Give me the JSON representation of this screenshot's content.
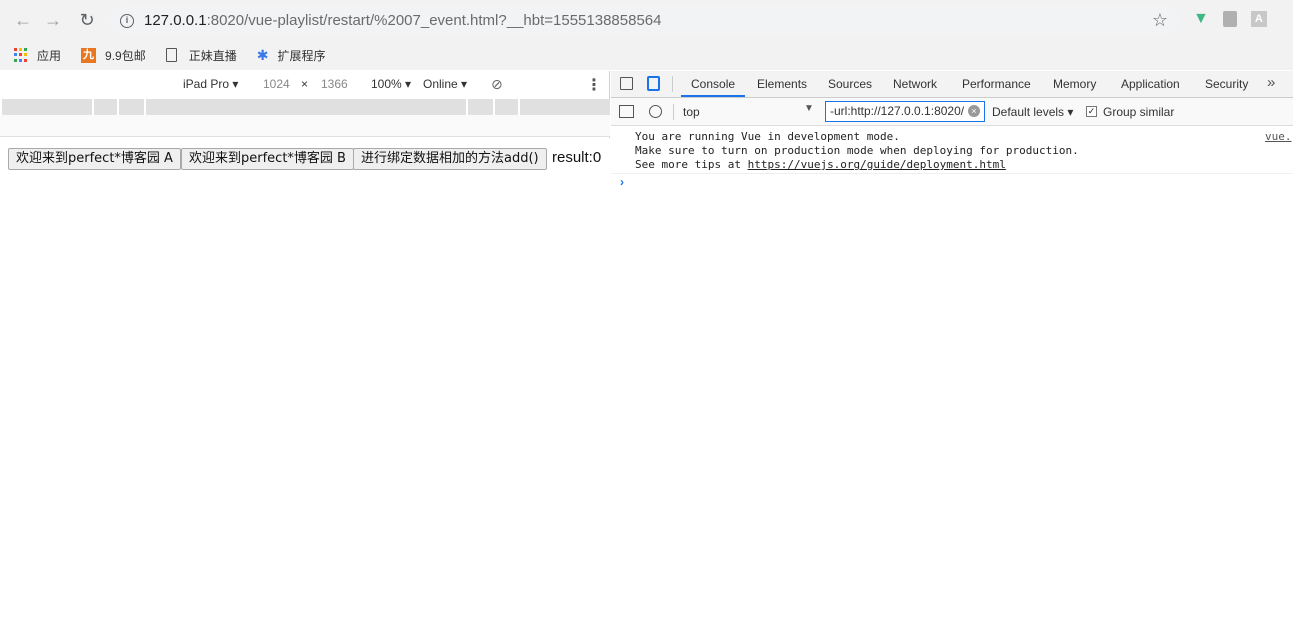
{
  "browser": {
    "url_host": "127.0.0.1",
    "url_path": ":8020/vue-playlist/restart/%2007_event.html?__hbt=1555138858564",
    "ext_letter": "A"
  },
  "bookmarks": [
    {
      "label": "应用"
    },
    {
      "label": "9.9包邮",
      "icon_text": "九"
    },
    {
      "label": "正妹直播"
    },
    {
      "label": "扩展程序"
    }
  ],
  "device_toolbar": {
    "device": "iPad Pro",
    "width": "1024",
    "times": "×",
    "height": "1366",
    "zoom": "100%",
    "network": "Online"
  },
  "page": {
    "buttons": [
      {
        "label": "欢迎来到perfect*博客园 A"
      },
      {
        "label": "欢迎来到perfect*博客园 B"
      },
      {
        "label": "进行绑定数据相加的方法add()"
      }
    ],
    "result": "result:0"
  },
  "devtools": {
    "tabs": [
      "Console",
      "Elements",
      "Sources",
      "Network",
      "Performance",
      "Memory",
      "Application",
      "Security"
    ],
    "active_tab": "Console",
    "context": "top",
    "filter_value": "-url:http://127.0.0.1:8020/",
    "levels": "Default levels",
    "group_similar": "Group similar",
    "messages": [
      "You are running Vue in development mode.",
      "Make sure to turn on production mode when deploying for production.",
      "See more tips at "
    ],
    "message_link": "https://vuejs.org/guide/deployment.html",
    "source_link": "vue."
  }
}
